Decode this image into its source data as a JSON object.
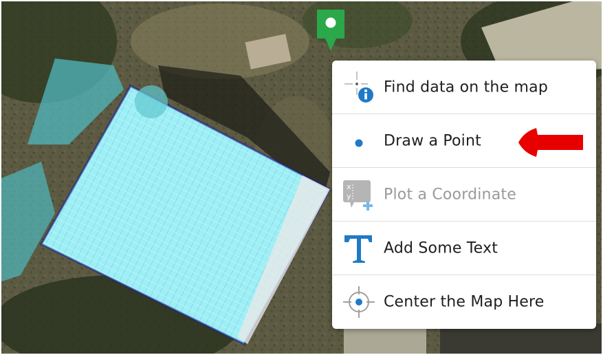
{
  "map": {
    "imagery": "aerial-satellite",
    "marker_icon": "map-pin-icon",
    "marker_color": "#2aa84a",
    "selection_color": "#8fe8f2"
  },
  "context_menu": {
    "items": [
      {
        "label": "Find data on the map",
        "icon": "identify-crosshair-info-icon",
        "enabled": true
      },
      {
        "label": "Draw a Point",
        "icon": "point-dot-icon",
        "enabled": true
      },
      {
        "label": "Plot a Coordinate",
        "icon": "plot-coordinate-xy-icon",
        "enabled": false
      },
      {
        "label": "Add Some Text",
        "icon": "text-t-icon",
        "enabled": true
      },
      {
        "label": "Center the Map Here",
        "icon": "center-crosshair-icon",
        "enabled": true
      }
    ]
  },
  "annotation": {
    "icon": "red-arrow-icon",
    "color": "#e80000"
  },
  "colors": {
    "icon_blue": "#1f7ac6",
    "disabled_gray": "#a8a8a8"
  }
}
